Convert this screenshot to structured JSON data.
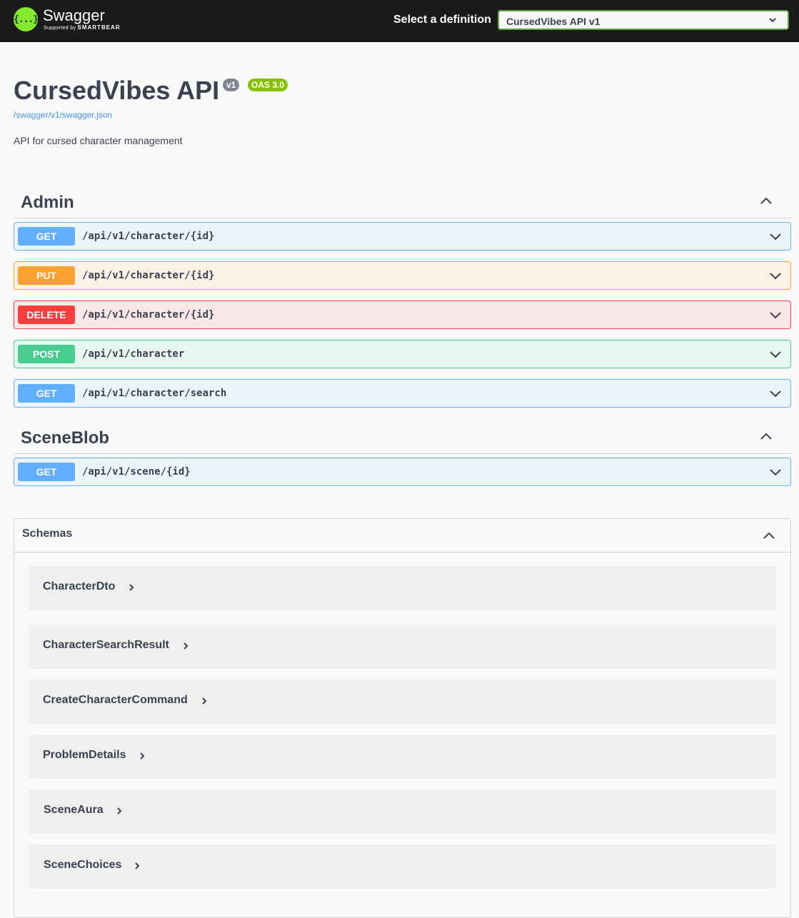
{
  "header": {
    "logo_title": "Swagger",
    "logo_sub_prefix": "Supported by",
    "logo_sub_brand": "SMARTBEAR",
    "logo_icon": "{...}",
    "definition_label": "Select a definition",
    "definition_value": "CursedVibes API v1"
  },
  "info": {
    "title": "CursedVibes API",
    "version_badge": "v1",
    "oas_badge": "OAS 3.0",
    "spec_url": "/swagger/v1/swagger.json",
    "description": "API for cursed character management"
  },
  "tags": [
    {
      "name": "Admin",
      "operations": [
        {
          "method": "GET",
          "path": "/api/v1/character/{id}"
        },
        {
          "method": "PUT",
          "path": "/api/v1/character/{id}"
        },
        {
          "method": "DELETE",
          "path": "/api/v1/character/{id}"
        },
        {
          "method": "POST",
          "path": "/api/v1/character"
        },
        {
          "method": "GET",
          "path": "/api/v1/character/search"
        }
      ]
    },
    {
      "name": "SceneBlob",
      "operations": [
        {
          "method": "GET",
          "path": "/api/v1/scene/{id}"
        }
      ]
    }
  ],
  "schemas": {
    "title": "Schemas",
    "models": [
      "CharacterDto",
      "CharacterSearchResult",
      "CreateCharacterCommand",
      "ProblemDetails",
      "SceneAura",
      "SceneChoices"
    ]
  },
  "colors": {
    "get": "#61affe",
    "put": "#fca130",
    "delete": "#f93e3e",
    "post": "#49cc90",
    "topbar": "#1b1b1b",
    "logo": "#85ea2d"
  }
}
